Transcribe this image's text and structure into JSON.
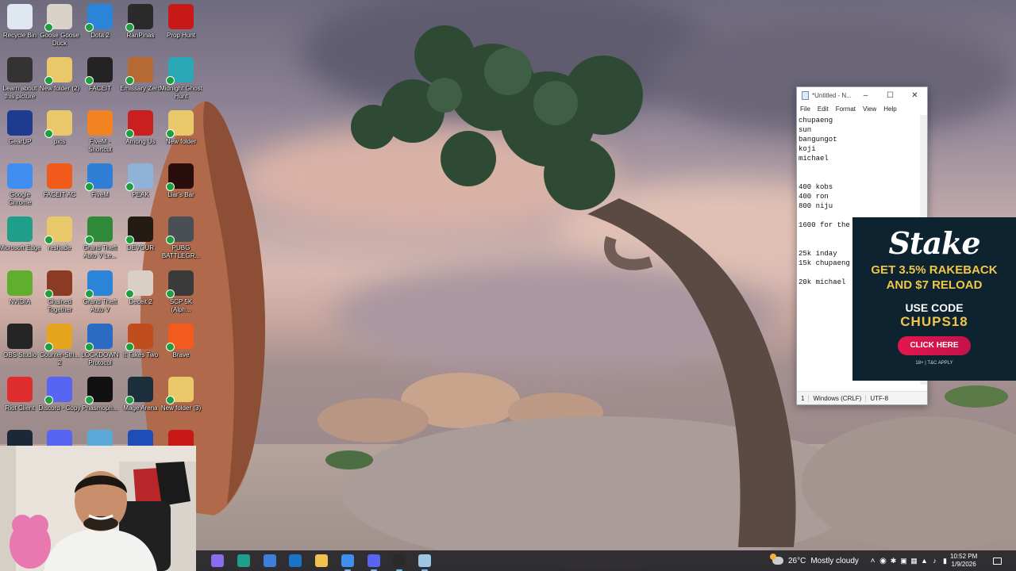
{
  "desktop": {
    "icons": [
      {
        "label": "Recycle Bin",
        "icon": "recycle-bin-icon",
        "color": "#dfe8f0",
        "badge": false
      },
      {
        "label": "Goose Goose Duck",
        "icon": "goose-goose-duck-icon",
        "color": "#d8d2c8",
        "badge": true
      },
      {
        "label": "Dota 2",
        "icon": "edge-legacy-icon",
        "color": "#2a84d8",
        "badge": true
      },
      {
        "label": "RanPinas",
        "icon": "ranpinas-icon",
        "color": "#2b2b2b",
        "badge": true
      },
      {
        "label": "Prop Hunt",
        "icon": "prop-hunt-icon",
        "color": "#c81818",
        "badge": false
      },
      {
        "label": "Learn about this picture",
        "icon": "camera-icon",
        "color": "#333333",
        "badge": false
      },
      {
        "label": "New folder (2)",
        "icon": "folder-icon",
        "color": "#e9c869",
        "badge": true
      },
      {
        "label": "FACEIT",
        "icon": "faceit-icon",
        "color": "#232323",
        "badge": true
      },
      {
        "label": "Emissary Zero",
        "icon": "emissary-zero-icon",
        "color": "#b56a34",
        "badge": true
      },
      {
        "label": "Midnight Ghost Hunt",
        "icon": "midnight-ghost-hunt-icon",
        "color": "#2aa8b6",
        "badge": true
      },
      {
        "label": "GearUP",
        "icon": "gearup-icon",
        "color": "#1d3c8f",
        "badge": false
      },
      {
        "label": "pics",
        "icon": "folder-icon",
        "color": "#e9c869",
        "badge": true
      },
      {
        "label": "FiveM - Shortcut",
        "icon": "fivem-icon",
        "color": "#f18323",
        "badge": false
      },
      {
        "label": "Among Us",
        "icon": "among-us-icon",
        "color": "#c9201f",
        "badge": true
      },
      {
        "label": "New folder",
        "icon": "folder-icon",
        "color": "#e9c869",
        "badge": true
      },
      {
        "label": "Google Chrome",
        "icon": "chrome-icon",
        "color": "#3f8ef0",
        "badge": false
      },
      {
        "label": "FACEIT AC",
        "icon": "faceit-ac-icon",
        "color": "#f05a1a",
        "badge": false
      },
      {
        "label": "FiveM",
        "icon": "fivem-icon",
        "color": "#2e7fd5",
        "badge": true
      },
      {
        "label": "PEAK",
        "icon": "peak-icon",
        "color": "#8fb3d8",
        "badge": true
      },
      {
        "label": "Liar's Bar",
        "icon": "liars-bar-icon",
        "color": "#2a0e0e",
        "badge": true
      },
      {
        "label": "Microsoft Edge",
        "icon": "edge-icon",
        "color": "#1f9e8c",
        "badge": false
      },
      {
        "label": "reshade",
        "icon": "folder-icon",
        "color": "#e9c869",
        "badge": true
      },
      {
        "label": "Grand Theft Auto V Le...",
        "icon": "gta-v-icon",
        "color": "#2f8a3a",
        "badge": true
      },
      {
        "label": "DEVOUR",
        "icon": "devour-icon",
        "color": "#231b14",
        "badge": true
      },
      {
        "label": "PUBG BATTLEGR...",
        "icon": "pubg-icon",
        "color": "#4a4f56",
        "badge": true
      },
      {
        "label": "NVIDIA",
        "icon": "nvidia-icon",
        "color": "#5fae2e",
        "badge": false
      },
      {
        "label": "Chained Together",
        "icon": "chained-together-icon",
        "color": "#8b3b24",
        "badge": true
      },
      {
        "label": "Grand Theft Auto V",
        "icon": "edge-legacy-icon",
        "color": "#2a84d8",
        "badge": true
      },
      {
        "label": "Deceit 2",
        "icon": "deceit-2-icon",
        "color": "#d9cfc4",
        "badge": true
      },
      {
        "label": "SCP 5K (Alph...",
        "icon": "scp-5k-icon",
        "color": "#3a3a3a",
        "badge": true
      },
      {
        "label": "OBS Studio",
        "icon": "obs-icon",
        "color": "#252525",
        "badge": false
      },
      {
        "label": "Counter-Stri... 2",
        "icon": "cs2-icon",
        "color": "#e6a51e",
        "badge": true
      },
      {
        "label": "LOCKDOWN Protocol",
        "icon": "lockdown-protocol-icon",
        "color": "#2b6cc2",
        "badge": true
      },
      {
        "label": "It Takes Two",
        "icon": "it-takes-two-icon",
        "color": "#c04d1d",
        "badge": true
      },
      {
        "label": "Brave",
        "icon": "brave-icon",
        "color": "#f25a1e",
        "badge": true
      },
      {
        "label": "Riot Client",
        "icon": "riot-client-icon",
        "color": "#e02d2d",
        "badge": false
      },
      {
        "label": "Discord - Copy",
        "icon": "discord-icon",
        "color": "#5865f2",
        "badge": true
      },
      {
        "label": "Phasmoph...",
        "icon": "phasmophobia-icon",
        "color": "#111111",
        "badge": true
      },
      {
        "label": "Mage Arena",
        "icon": "mage-arena-icon",
        "color": "#1c2f3c",
        "badge": true
      },
      {
        "label": "New folder (3)",
        "icon": "folder-icon",
        "color": "#e9c869",
        "badge": true
      },
      {
        "label": "",
        "icon": "steam-icon",
        "color": "#1b2838",
        "badge": false
      },
      {
        "label": "",
        "icon": "discord-icon",
        "color": "#5865f2",
        "badge": false
      },
      {
        "label": "",
        "icon": "app-icon",
        "color": "#5aa9d8",
        "badge": false
      },
      {
        "label": "",
        "icon": "bet-icon",
        "color": "#1f4db8",
        "badge": false
      },
      {
        "label": "",
        "icon": "app-icon",
        "color": "#c81818",
        "badge": false
      }
    ]
  },
  "notepad": {
    "title": "*Untitled - N...",
    "menu": [
      "File",
      "Edit",
      "Format",
      "View",
      "Help"
    ],
    "lines": [
      "chupaeng",
      "sun",
      "bangungot",
      "koji",
      "michael",
      "",
      "",
      "400 kobs",
      "400 ron",
      "800 niju",
      "",
      "1600 for the",
      "",
      "",
      "25k inday",
      "15k chupaeng",
      "",
      "20k michael"
    ],
    "status": {
      "line_ending": "Windows (CRLF)",
      "position": "1",
      "encoding": "UTF-8"
    }
  },
  "ad": {
    "brand": "Stake",
    "headline_1": "GET 3.5% RAKEBACK",
    "headline_2": "AND $7 RELOAD",
    "use_code": "USE CODE",
    "code": "CHUPS18",
    "cta": "CLICK HERE",
    "fine_print": "18+ | T&C APPLY"
  },
  "taskbar": {
    "apps": [
      {
        "icon": "copilot-icon",
        "color": "#8a6cf0",
        "active": false
      },
      {
        "icon": "edge-icon",
        "color": "#1f9e8c",
        "active": false
      },
      {
        "icon": "microsoft-store-icon",
        "color": "#3d7fdc",
        "active": false
      },
      {
        "icon": "outlook-icon",
        "color": "#1a73c8",
        "active": false
      },
      {
        "icon": "file-explorer-icon",
        "color": "#f2c14e",
        "active": false
      },
      {
        "icon": "chrome-icon",
        "color": "#3f8ef0",
        "active": true
      },
      {
        "icon": "discord-icon",
        "color": "#5865f2",
        "active": true
      },
      {
        "icon": "obs-icon",
        "color": "#2a2a2a",
        "active": true
      },
      {
        "icon": "notepad-icon",
        "color": "#9fc6e3",
        "active": true
      }
    ],
    "weather": {
      "temp": "26°C",
      "condition": "Mostly cloudy"
    },
    "tray_icons": [
      "chevron-up-icon",
      "obs-tray-icon",
      "bluetooth-icon",
      "speaker-tray-icon",
      "app-tray-icon",
      "wifi-icon",
      "volume-icon",
      "battery-icon"
    ],
    "clock": {
      "time": "10:52 PM",
      "date": "1/9/2026"
    }
  }
}
